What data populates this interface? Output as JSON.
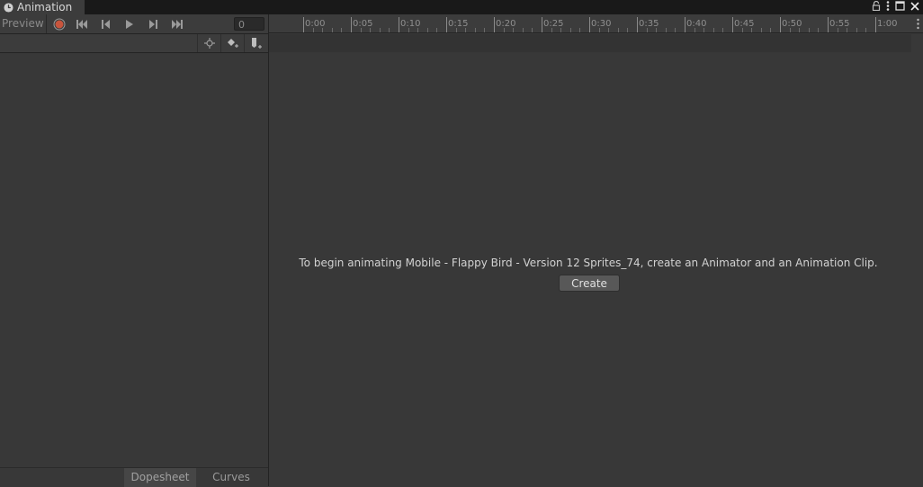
{
  "window": {
    "tab_title": "Animation",
    "tab_icon": "clock-icon",
    "controls": [
      "lock-icon",
      "kebab-menu-icon",
      "maximize-icon",
      "close-icon"
    ]
  },
  "toolbar": {
    "preview_label": "Preview",
    "buttons": [
      "record-icon",
      "first-keyframe-icon",
      "prev-keyframe-icon",
      "play-icon",
      "next-keyframe-icon",
      "last-keyframe-icon"
    ],
    "frame_value": "0",
    "record_color": "#c8553d"
  },
  "toolbar2": {
    "buttons": [
      "filter-keyframe-icon",
      "add-keyframe-icon",
      "add-event-icon"
    ]
  },
  "timeline": {
    "ticks": [
      "0:00",
      "0:05",
      "0:10",
      "0:15",
      "0:20",
      "0:25",
      "0:30",
      "0:35",
      "0:40",
      "0:45",
      "0:50",
      "0:55",
      "1:00"
    ]
  },
  "main": {
    "message": "To begin animating Mobile - Flappy Bird - Version 12 Sprites_74, create an Animator and an Animation Clip.",
    "create_label": "Create"
  },
  "bottom_tabs": {
    "dopesheet": "Dopesheet",
    "curves": "Curves",
    "active": "Dopesheet"
  }
}
